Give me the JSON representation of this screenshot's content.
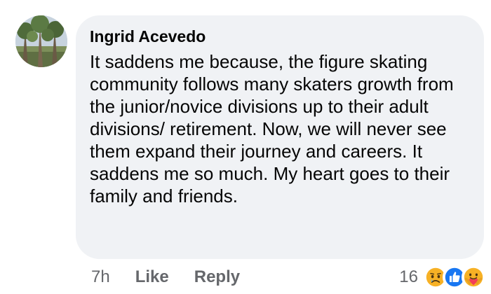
{
  "comment": {
    "author": "Ingrid Acevedo",
    "text": "It saddens me because, the figure skating community follows many skaters growth from the junior/novice divisions up to their adult divisions/ retirement. Now, we will never see them expand their journey and careers. It saddens me so much. My heart goes to their family and friends.",
    "time": "7h",
    "like_label": "Like",
    "reply_label": "Reply",
    "reaction_count": "16",
    "reactions": [
      "sad-icon",
      "like-icon",
      "care-icon"
    ]
  },
  "colors": {
    "bubble": "#f0f2f5",
    "text": "#050505",
    "meta": "#65676b",
    "like_blue": "#1877f2",
    "care_red": "#f33e58",
    "emoji_yellow": "#f7b125"
  }
}
